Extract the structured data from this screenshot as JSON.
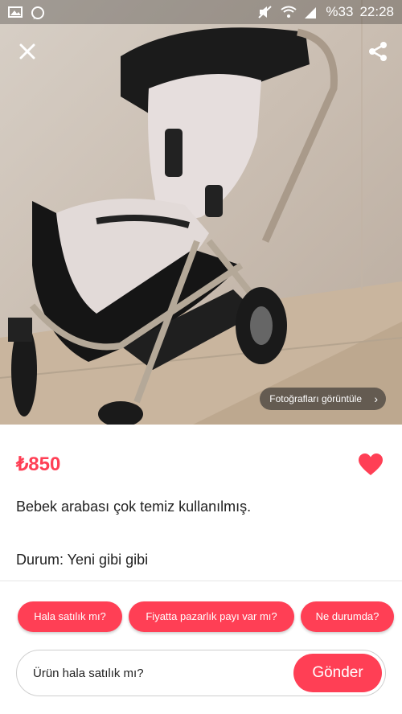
{
  "status_bar": {
    "battery": "%33",
    "time": "22:28"
  },
  "listing": {
    "photo_button": "Fotoğrafları görüntüle",
    "price": "₺850",
    "title": "Bebek arabası çok temiz kullanılmış.",
    "condition": "Durum: Yeni gibi gibi"
  },
  "quick_replies": [
    {
      "label": "Hala satılık mı?"
    },
    {
      "label": "Fiyatta pazarlık payı var mı?"
    },
    {
      "label": "Ne durumda?"
    }
  ],
  "message": {
    "value": "Ürün hala satılık mı?",
    "send_label": "Gönder"
  },
  "colors": {
    "accent": "#ff3f55",
    "background": "#ffffff"
  },
  "icons": {
    "close": "close-icon",
    "share": "share-icon",
    "favorite": "heart-icon",
    "gallery": "image-icon",
    "whatsapp": "whatsapp-icon",
    "wifi": "wifi-icon",
    "signal": "signal-icon",
    "mute": "mute-icon"
  }
}
